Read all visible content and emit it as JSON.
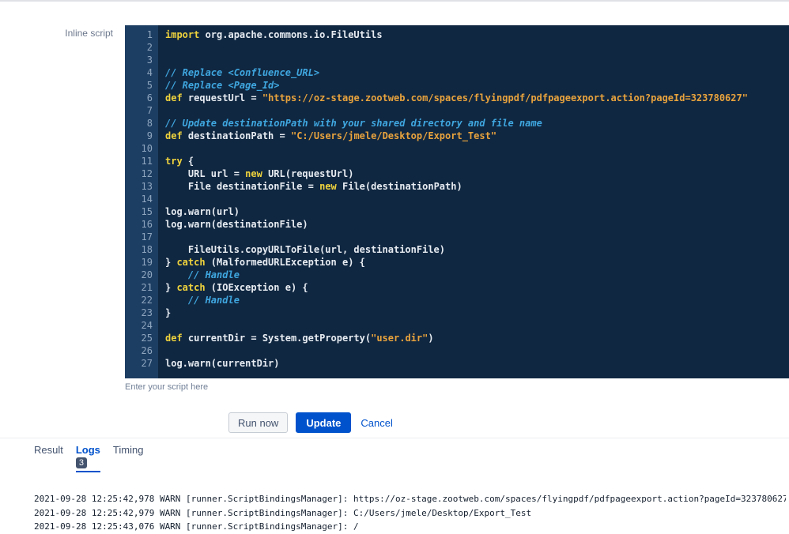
{
  "form": {
    "label": "Inline script",
    "hint": "Enter your script here"
  },
  "editor": {
    "lines": [
      [
        [
          "kw",
          "import"
        ],
        [
          "pl",
          " org.apache.commons.io.FileUtils"
        ]
      ],
      [],
      [],
      [
        [
          "cm",
          "// Replace <Confluence_URL>"
        ]
      ],
      [
        [
          "cm",
          "// Replace <Page_Id>"
        ]
      ],
      [
        [
          "kw",
          "def"
        ],
        [
          "pl",
          " requestUrl = "
        ],
        [
          "str",
          "\"https://oz-stage.zootweb.com/spaces/flyingpdf/pdfpageexport.action?pageId=323780627\""
        ]
      ],
      [],
      [
        [
          "cm",
          "// Update destinationPath with your shared directory and file name"
        ]
      ],
      [
        [
          "kw",
          "def"
        ],
        [
          "pl",
          " destinationPath = "
        ],
        [
          "str",
          "\"C:/Users/jmele/Desktop/Export_Test\""
        ]
      ],
      [],
      [
        [
          "kw",
          "try"
        ],
        [
          "pl",
          " {"
        ]
      ],
      [
        [
          "pl",
          "    URL url = "
        ],
        [
          "kw",
          "new"
        ],
        [
          "pl",
          " URL(requestUrl)"
        ]
      ],
      [
        [
          "pl",
          "    File destinationFile = "
        ],
        [
          "kw",
          "new"
        ],
        [
          "pl",
          " File(destinationPath)"
        ]
      ],
      [],
      [
        [
          "pl",
          "log.warn(url)"
        ]
      ],
      [
        [
          "pl",
          "log.warn(destinationFile)"
        ]
      ],
      [],
      [
        [
          "pl",
          "    FileUtils.copyURLToFile(url, destinationFile)"
        ]
      ],
      [
        [
          "pl",
          "} "
        ],
        [
          "kw",
          "catch"
        ],
        [
          "pl",
          " (MalformedURLException e) {"
        ]
      ],
      [
        [
          "cm",
          "    // Handle"
        ]
      ],
      [
        [
          "pl",
          "} "
        ],
        [
          "kw",
          "catch"
        ],
        [
          "pl",
          " (IOException e) {"
        ]
      ],
      [
        [
          "cm",
          "    // Handle"
        ]
      ],
      [
        [
          "pl",
          "}"
        ]
      ],
      [],
      [
        [
          "kw",
          "def"
        ],
        [
          "pl",
          " currentDir = System.getProperty("
        ],
        [
          "str",
          "\"user.dir\""
        ],
        [
          "pl",
          ")"
        ]
      ],
      [],
      [
        [
          "pl",
          "log.warn(currentDir)"
        ]
      ]
    ]
  },
  "buttons": {
    "run": "Run now",
    "update": "Update",
    "cancel": "Cancel"
  },
  "tabs": {
    "result": "Result",
    "logs": "Logs",
    "logs_badge": "3",
    "timing": "Timing"
  },
  "logs": {
    "lines": [
      "2021-09-28 12:25:42,978 WARN [runner.ScriptBindingsManager]: https://oz-stage.zootweb.com/spaces/flyingpdf/pdfpageexport.action?pageId=323780627",
      "2021-09-28 12:25:42,979 WARN [runner.ScriptBindingsManager]: C:/Users/jmele/Desktop/Export_Test",
      "2021-09-28 12:25:43,076 WARN [runner.ScriptBindingsManager]: /"
    ]
  },
  "colors": {
    "accent": "#0052CC",
    "editor_bg": "#102741",
    "gutter_bg": "#1D3E63",
    "line_number": "#8FA6BF",
    "code_text": "#E7ECF2",
    "keyword": "#EFD33D",
    "comment": "#3FA7E0",
    "string": "#E8A33D",
    "badge_bg": "#44546F"
  }
}
